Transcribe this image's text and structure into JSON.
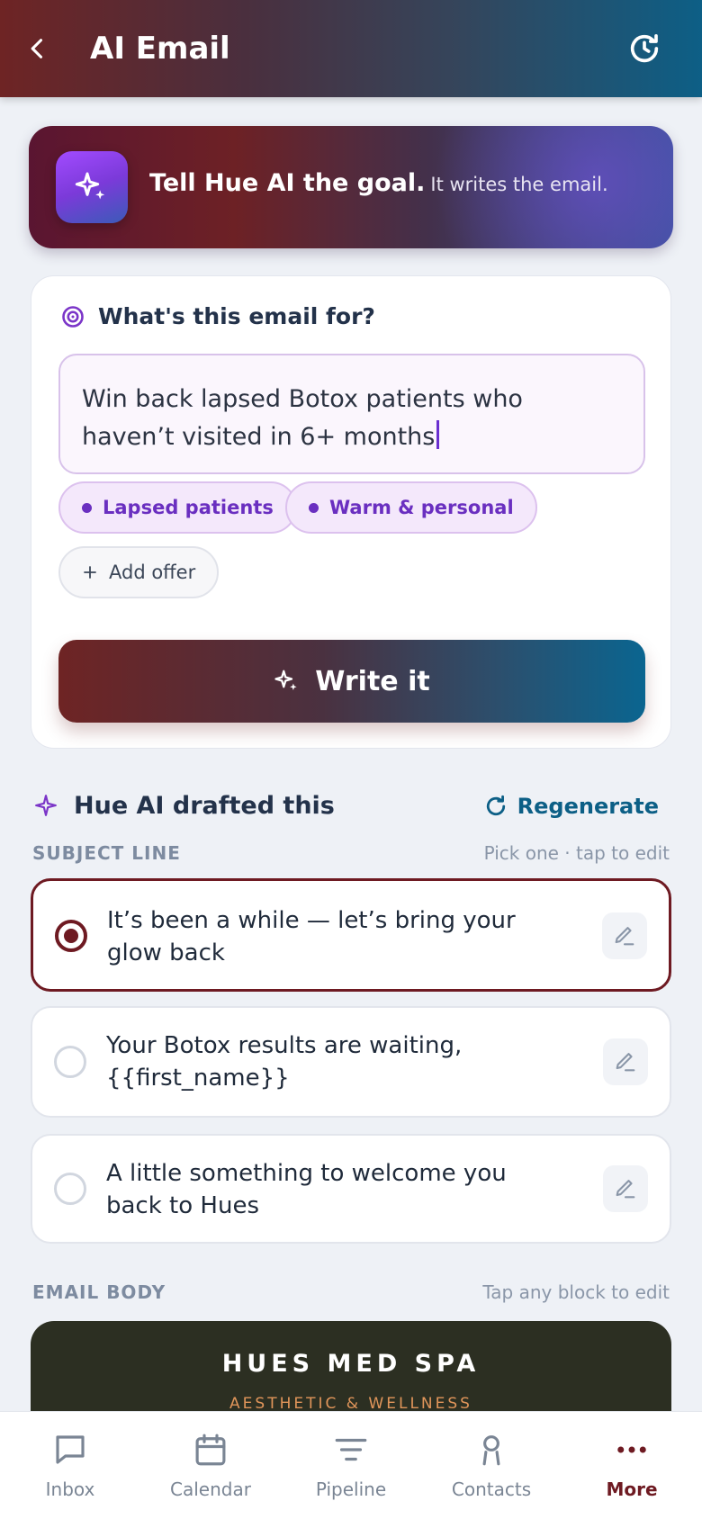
{
  "header": {
    "title": "AI Email"
  },
  "banner": {
    "strong": "Tell Hue AI the goal.",
    "light": "It writes the email."
  },
  "goal": {
    "label": "What's this email for?",
    "input_value": "Win back lapsed Botox patients who haven’t visited in 6+ months",
    "chips": [
      "Lapsed patients",
      "Warm & personal"
    ],
    "add_chip": "Add offer",
    "write_button": "Write it"
  },
  "draft": {
    "title": "Hue AI drafted this",
    "regenerate": "Regenerate",
    "subject_label": "SUBJECT LINE",
    "subject_hint": "Pick one · tap to edit",
    "subjects": [
      "It’s been a while — let’s bring your glow back",
      "Your Botox results are waiting, {{first_name}}",
      "A little something to welcome you back to Hues"
    ],
    "selected_index": 0,
    "body_label": "EMAIL BODY",
    "body_hint": "Tap any block to edit",
    "brand_name": "HUES MED SPA",
    "brand_tagline": "AESTHETIC & WELLNESS"
  },
  "nav": {
    "items": [
      "Inbox",
      "Calendar",
      "Pipeline",
      "Contacts",
      "More"
    ],
    "active": "More"
  },
  "colors": {
    "accent_maroon": "#6e1a22",
    "accent_teal": "#0c5f86",
    "accent_purple": "#6a2fc0"
  },
  "icons": {
    "back": "chevron-left-icon",
    "history": "history-icon",
    "sparkle": "sparkle-icon",
    "target": "target-icon",
    "regenerate": "refresh-icon",
    "edit": "pencil-icon"
  }
}
